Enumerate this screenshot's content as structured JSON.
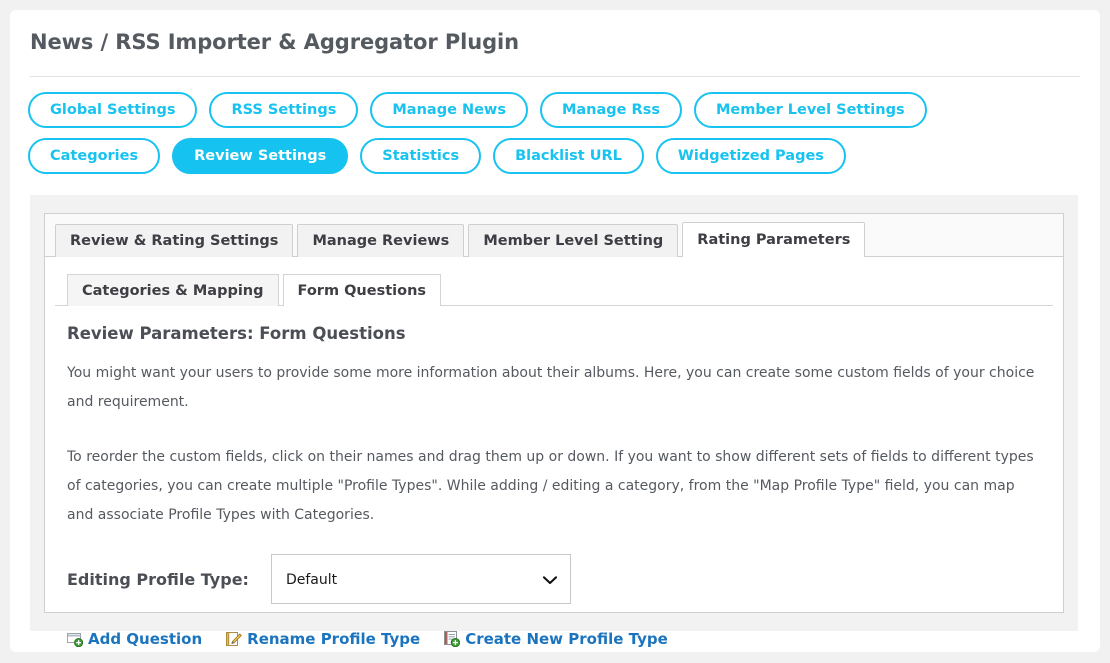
{
  "page": {
    "title": "News / RSS Importer & Aggregator Plugin"
  },
  "nav_pills": [
    {
      "label": "Global Settings",
      "active": false
    },
    {
      "label": "RSS Settings",
      "active": false
    },
    {
      "label": "Manage News",
      "active": false
    },
    {
      "label": "Manage Rss",
      "active": false
    },
    {
      "label": "Member Level Settings",
      "active": false
    },
    {
      "label": "Categories",
      "active": false
    },
    {
      "label": "Review Settings",
      "active": true
    },
    {
      "label": "Statistics",
      "active": false
    },
    {
      "label": "Blacklist URL",
      "active": false
    },
    {
      "label": "Widgetized Pages",
      "active": false
    }
  ],
  "tabs": [
    {
      "label": "Review & Rating Settings",
      "active": false
    },
    {
      "label": "Manage Reviews",
      "active": false
    },
    {
      "label": "Member Level Setting",
      "active": false
    },
    {
      "label": "Rating Parameters",
      "active": true
    }
  ],
  "subtabs": [
    {
      "label": "Categories & Mapping",
      "active": false
    },
    {
      "label": "Form Questions",
      "active": true
    }
  ],
  "content": {
    "heading": "Review Parameters: Form Questions",
    "paragraph_1": "You might want your users to provide some more information about their albums. Here, you can create some custom fields of your choice and requirement.",
    "paragraph_2": "To reorder the custom fields, click on their names and drag them up or down. If you want to show different sets of fields to different types of categories, you can create multiple \"Profile Types\". While adding / editing a category, from the \"Map Profile Type\" field, you can map and associate Profile Types with Categories.",
    "profile_type_label": "Editing Profile Type:",
    "profile_type_value": "Default",
    "profile_type_options": [
      "Default"
    ]
  },
  "actions": [
    {
      "label": "Add Question",
      "icon": "add-question-icon"
    },
    {
      "label": "Rename Profile Type",
      "icon": "rename-pencil-icon"
    },
    {
      "label": "Create New Profile Type",
      "icon": "create-new-icon"
    }
  ],
  "colors": {
    "accent_cyan": "#16c2f0",
    "link_blue": "#1b74bd",
    "text_grey": "#555a60",
    "page_bg": "#f1f1f1"
  }
}
